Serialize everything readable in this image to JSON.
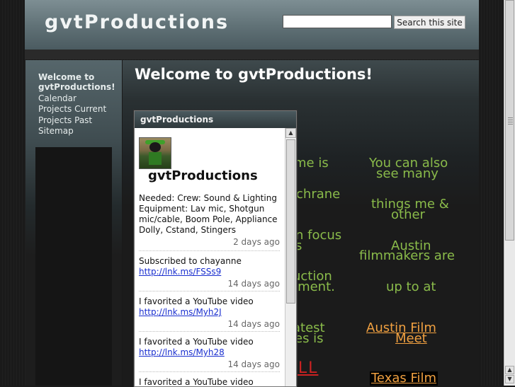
{
  "header": {
    "site_title": "gvtProductions",
    "search_button_label": "Search this site",
    "search_value": ""
  },
  "sidebar": {
    "items": [
      {
        "label": "Welcome to gvtProductions!",
        "active": true
      },
      {
        "label": "Calendar"
      },
      {
        "label": "Projects Current"
      },
      {
        "label": "Projects Past"
      },
      {
        "label": "Sitemap"
      }
    ]
  },
  "main": {
    "title": "Welcome to gvtProductions!",
    "left_fragments": [
      "me is",
      "ochrane",
      "n focus",
      "s",
      "uction",
      "ement.",
      "atest",
      "res is",
      "ELL"
    ],
    "right_text": {
      "p1_line1": "You can also",
      "p1_line2": "see many",
      "p2_line1": "things me &",
      "p2_line2": "other",
      "p3_line1": "Austin",
      "p3_line2": "filmmakers are",
      "p4": "up to at",
      "link1_line1": "Austin Film",
      "link1_line2": "Meet",
      "link2_line1": "Texas Film"
    }
  },
  "widget": {
    "header": "gvtProductions",
    "profile_name": "gvtProductions",
    "posts": [
      {
        "text": "Needed: Crew: Sound & Lighting Equipment: Lav mic, Shotgun mic/cable, Boom Pole, Appliance Dolly, Cstand, Stingers",
        "link": "",
        "time": "2 days ago"
      },
      {
        "text": "Subscribed to chayanne",
        "link": "http://lnk.ms/FSSs9",
        "time": "14 days ago"
      },
      {
        "text": "I favorited a YouTube video",
        "link": "http://lnk.ms/Myh2J",
        "time": "14 days ago"
      },
      {
        "text": "I favorited a YouTube video",
        "link": "http://lnk.ms/Myh28",
        "time": "14 days ago"
      },
      {
        "text": "I favorited a YouTube video",
        "link": "",
        "time": ""
      }
    ]
  },
  "colors": {
    "header_bg": "#6f8085",
    "green_text": "#8abb4a",
    "orange_link": "#f0a040",
    "red_link": "#cc2222"
  },
  "icons": {
    "scroll_up": "triangle-up-icon",
    "scroll_down": "triangle-down-icon"
  }
}
